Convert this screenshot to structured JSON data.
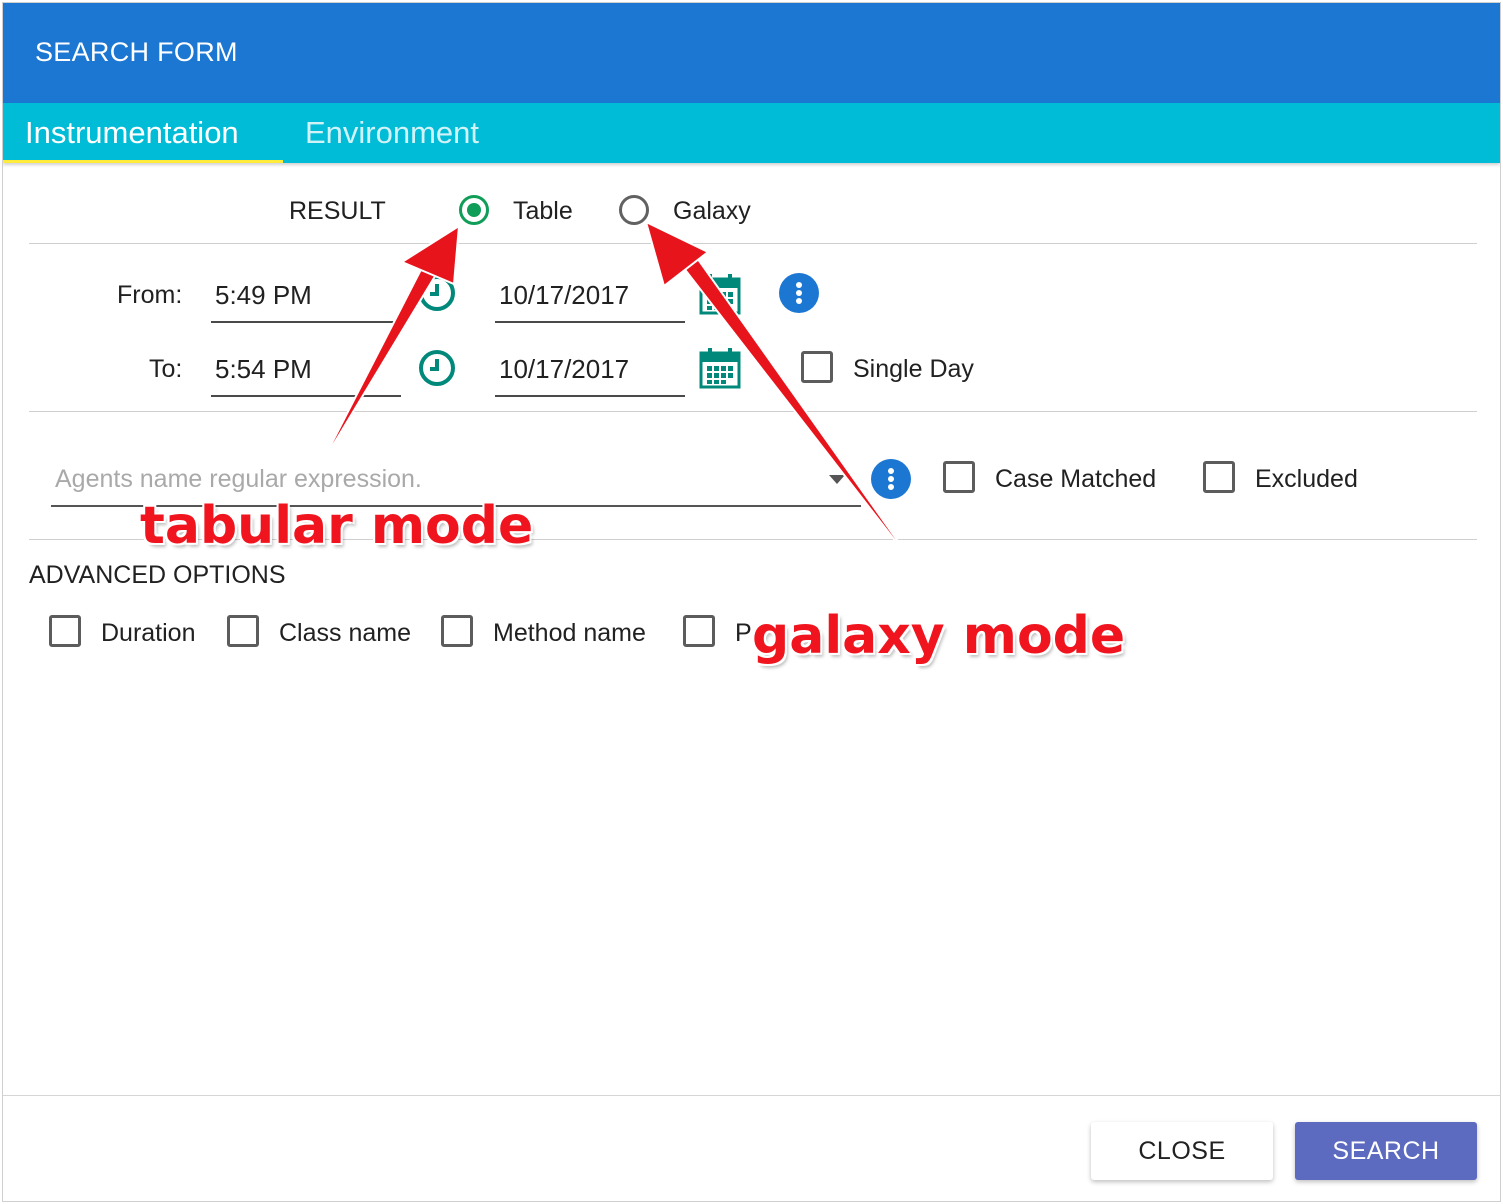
{
  "window": {
    "title": "SEARCH FORM"
  },
  "tabs": [
    {
      "label": "Instrumentation",
      "active": true
    },
    {
      "label": "Environment",
      "active": false
    }
  ],
  "result": {
    "label": "RESULT",
    "options": [
      {
        "label": "Table",
        "selected": true
      },
      {
        "label": "Galaxy",
        "selected": false
      }
    ]
  },
  "from": {
    "label": "From:",
    "time": "5:49 PM",
    "date": "10/17/2017"
  },
  "to": {
    "label": "To:",
    "time": "5:54 PM",
    "date": "10/17/2017"
  },
  "single_day": {
    "label": "Single Day",
    "checked": false
  },
  "agents": {
    "placeholder": "Agents name regular expression.",
    "case_matched": {
      "label": "Case Matched",
      "checked": false
    },
    "excluded": {
      "label": "Excluded",
      "checked": false
    }
  },
  "advanced": {
    "title": "ADVANCED OPTIONS",
    "options": [
      {
        "label": "Duration",
        "checked": false
      },
      {
        "label": "Class name",
        "checked": false
      },
      {
        "label": "Method name",
        "checked": false
      },
      {
        "label": "P",
        "checked": false
      }
    ]
  },
  "buttons": {
    "close": "CLOSE",
    "search": "SEARCH"
  },
  "annotations": {
    "tabular": "tabular mode",
    "galaxy": "galaxy mode"
  },
  "colors": {
    "titlebar": "#1c77d3",
    "tabbar": "#00bcd6",
    "tab_indicator": "#ffeb3b",
    "radio_selected": "#0f9d58",
    "icon_teal": "#00897b",
    "search_button": "#5c6bc0",
    "annotation_red": "#f0141e"
  },
  "icons": [
    "clock-icon",
    "calendar-icon",
    "info-icon",
    "dropdown-arrow-icon"
  ]
}
